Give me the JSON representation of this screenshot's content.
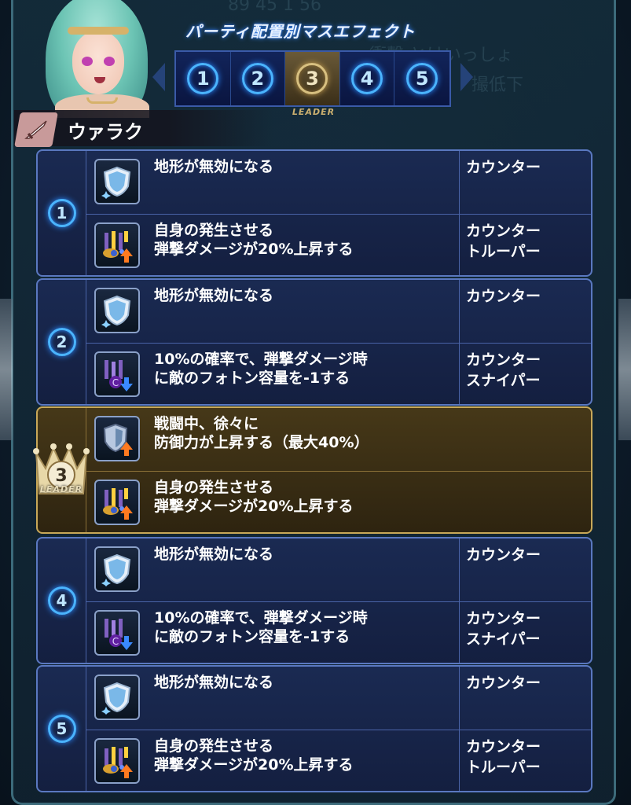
{
  "header": {
    "title": "パーティ配置別マスエフェクト",
    "leader_tab_label": "LEADER"
  },
  "tabs": [
    {
      "num": "1",
      "active": false
    },
    {
      "num": "2",
      "active": false
    },
    {
      "num": "3",
      "active": true
    },
    {
      "num": "4",
      "active": false
    },
    {
      "num": "5",
      "active": false
    }
  ],
  "unit": {
    "name": "ウァラク"
  },
  "background_text": {
    "line1": "衝撃 とけいっしょ",
    "line2": "撮低下",
    "stats": "89 45 1 56"
  },
  "slots": [
    {
      "num": "1",
      "effects": [
        {
          "icon": "shield-icon",
          "text": "地形が無効になる",
          "cond": "カウンター"
        },
        {
          "icon": "attack-up-icon",
          "text": "自身の発生させる\n弾撃ダメージが20%上昇する",
          "cond": "カウンター\nトルーパー"
        }
      ]
    },
    {
      "num": "2",
      "effects": [
        {
          "icon": "shield-icon",
          "text": "地形が無効になる",
          "cond": "カウンター"
        },
        {
          "icon": "photon-down-icon",
          "text": "10%の確率で、弾撃ダメージ時\nに敵のフォトン容量を-1する",
          "cond": "カウンター\nスナイパー"
        }
      ]
    },
    {
      "num": "3",
      "leader": true,
      "leader_label": "LEADER",
      "effects": [
        {
          "icon": "defense-up-icon",
          "text": "戦闘中、徐々に\n防御力が上昇する（最大40%）",
          "cond": ""
        },
        {
          "icon": "attack-up-icon",
          "text": "自身の発生させる\n弾撃ダメージが20%上昇する",
          "cond": ""
        }
      ]
    },
    {
      "num": "4",
      "effects": [
        {
          "icon": "shield-icon",
          "text": "地形が無効になる",
          "cond": "カウンター"
        },
        {
          "icon": "photon-down-icon",
          "text": "10%の確率で、弾撃ダメージ時\nに敵のフォトン容量を-1する",
          "cond": "カウンター\nスナイパー"
        }
      ]
    },
    {
      "num": "5",
      "effects": [
        {
          "icon": "shield-icon",
          "text": "地形が無効になる",
          "cond": "カウンター"
        },
        {
          "icon": "attack-up-icon",
          "text": "自身の発生させる\n弾撃ダメージが20%上昇する",
          "cond": "カウンター\nトルーパー"
        }
      ]
    }
  ],
  "colors": {
    "accent_blue": "#4ab4ff",
    "leader_gold": "#c8a858",
    "panel": "#1a2a52"
  }
}
